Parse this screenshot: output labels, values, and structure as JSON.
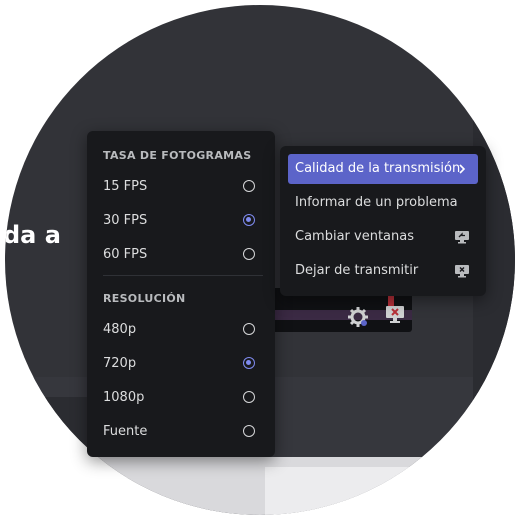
{
  "background": {
    "partial_text": "da a"
  },
  "frame_rate_menu": {
    "header": "TASA DE FOTOGRAMAS",
    "options": [
      {
        "label": "15 FPS",
        "selected": false
      },
      {
        "label": "30 FPS",
        "selected": true
      },
      {
        "label": "60 FPS",
        "selected": false
      }
    ]
  },
  "resolution_menu": {
    "header": "RESOLUCIÓN",
    "options": [
      {
        "label": "480p",
        "selected": false
      },
      {
        "label": "720p",
        "selected": true
      },
      {
        "label": "1080p",
        "selected": false
      },
      {
        "label": "Fuente",
        "selected": false
      }
    ]
  },
  "context_menu": {
    "items": [
      {
        "label": "Calidad de la transmisión",
        "icon": "chevron-right-icon",
        "active": true
      },
      {
        "label": "Informar de un problema",
        "icon": "",
        "active": false
      },
      {
        "label": "Cambiar ventanas",
        "icon": "screen-swap-icon",
        "active": false
      },
      {
        "label": "Dejar de transmitir",
        "icon": "screen-close-icon",
        "active": false
      }
    ]
  },
  "colors": {
    "accent": "#5c64c9",
    "menu_bg": "#18191c",
    "app_bg": "#323338",
    "radio_checked": "#7f8bf0"
  }
}
